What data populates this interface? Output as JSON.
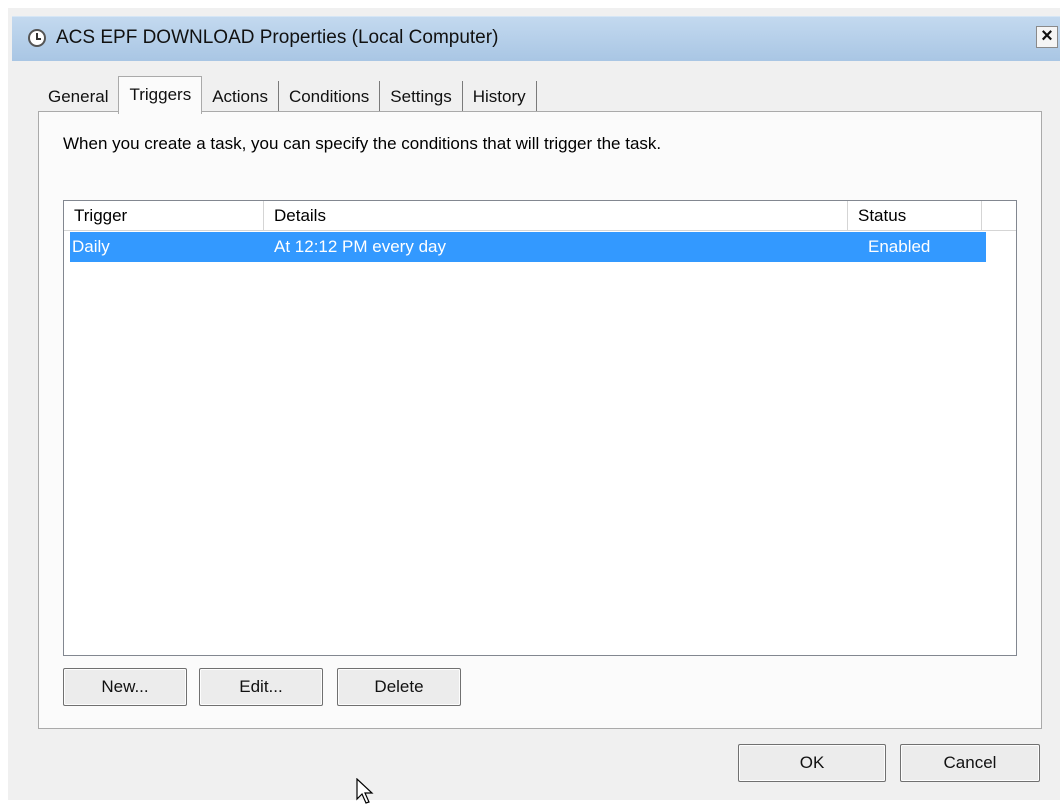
{
  "window": {
    "title": "ACS EPF DOWNLOAD Properties (Local Computer)",
    "close_label": "×"
  },
  "tabs": [
    {
      "label": "General"
    },
    {
      "label": "Triggers",
      "active": true
    },
    {
      "label": "Actions"
    },
    {
      "label": "Conditions"
    },
    {
      "label": "Settings"
    },
    {
      "label": "History"
    }
  ],
  "triggers_tab": {
    "description": "When you create a task, you can specify the conditions that will trigger the task.",
    "columns": [
      "Trigger",
      "Details",
      "Status"
    ],
    "rows": [
      {
        "trigger": "Daily",
        "details": "At 12:12 PM every day",
        "status": "Enabled",
        "selected": true
      }
    ],
    "buttons": {
      "new": "New...",
      "edit": "Edit...",
      "delete": "Delete"
    }
  },
  "footer": {
    "ok": "OK",
    "cancel": "Cancel"
  },
  "colors": {
    "selection": "#3399ff",
    "titlebar": "#b9d1ea"
  }
}
